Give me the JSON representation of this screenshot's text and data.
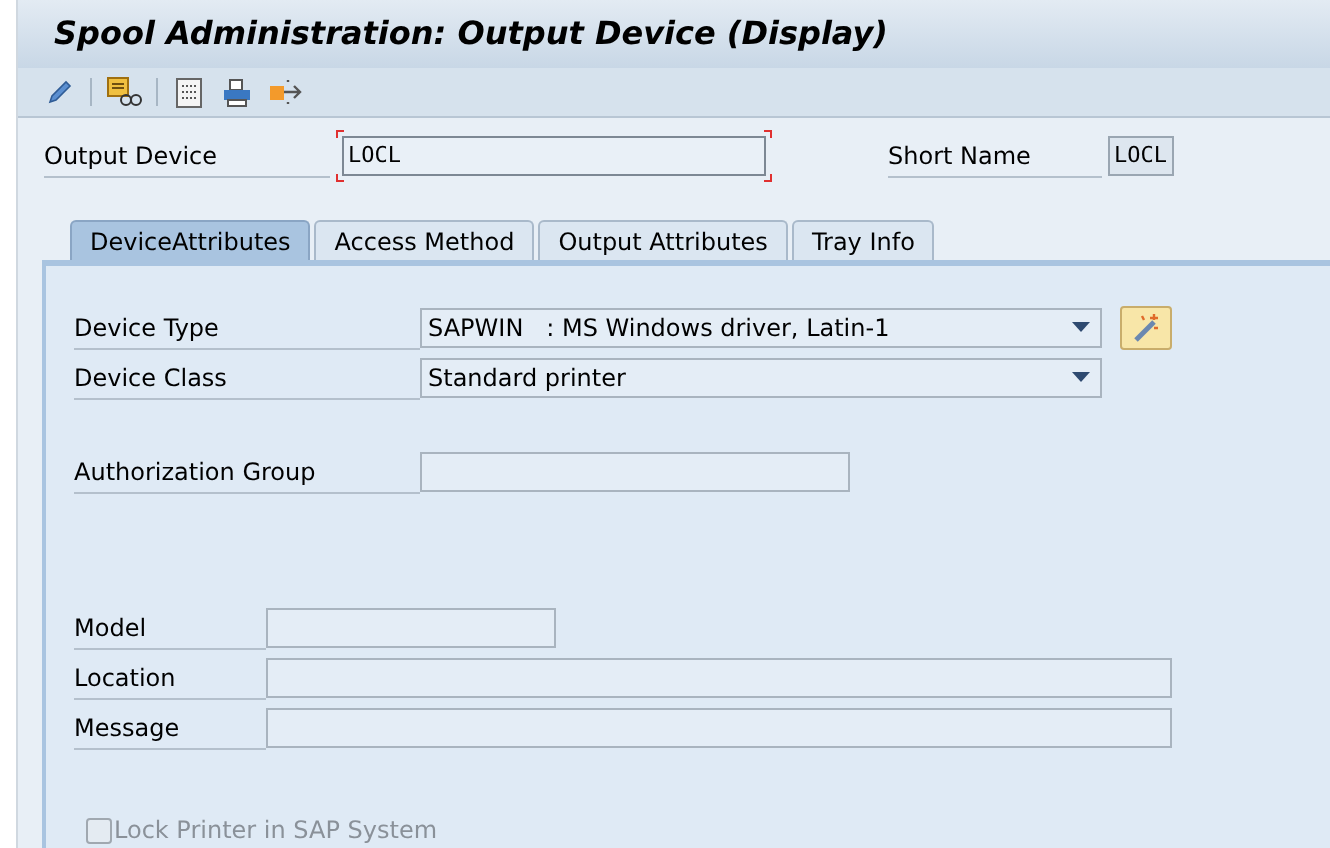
{
  "window": {
    "title": "Spool Administration: Output Device (Display)"
  },
  "header": {
    "output_device": {
      "label": "Output Device",
      "value": "LOCL",
      "focused": true
    },
    "short_name": {
      "label": "Short Name",
      "value": "LOCL"
    }
  },
  "tabs": [
    {
      "label": "DeviceAttributes",
      "selected": true
    },
    {
      "label": "Access Method",
      "selected": false
    },
    {
      "label": "Output Attributes",
      "selected": false
    },
    {
      "label": "Tray Info",
      "selected": false
    }
  ],
  "field_groups": [
    [
      {
        "kind": "dropdown",
        "label": "Device Type",
        "value": "SAPWIN   : MS Windows driver, Latin-1",
        "wizard": true
      },
      {
        "kind": "dropdown",
        "label": "Device Class",
        "value": "Standard printer",
        "wizard": false
      }
    ],
    [
      {
        "kind": "input",
        "label": "Authorization Group"
      }
    ],
    [
      {
        "kind": "input",
        "label": "Model"
      },
      {
        "kind": "input",
        "label": "Location"
      },
      {
        "kind": "input",
        "label": "Message"
      }
    ]
  ],
  "lock_printer": {
    "label": "Lock Printer in SAP System",
    "checked": false,
    "disabled": true
  }
}
